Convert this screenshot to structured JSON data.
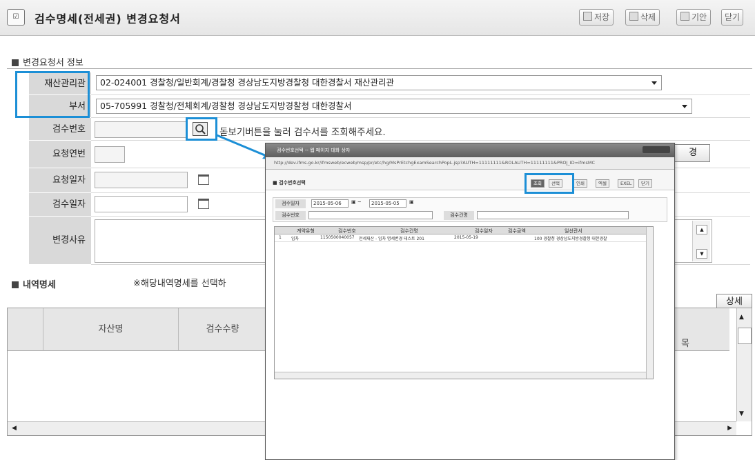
{
  "window": {
    "title": "검수명세(전세권) 변경요청서"
  },
  "toolbar": {
    "save": "저장",
    "delete": "삭제",
    "draft": "기안",
    "close": "닫기"
  },
  "section_info": {
    "title": "변경요청서 정보"
  },
  "form": {
    "asset_manager": {
      "label": "재산관리관",
      "value": "02-024001 경찰청/일반회계/경찰청 경상남도지방경찰청 대한경찰서 재산관리관"
    },
    "department": {
      "label": "부서",
      "value": "05-705991 경찰청/전체회계/경찰청 경상남도지방경찰청 대한경찰서"
    },
    "inspection_no": {
      "label": "검수번호",
      "hint": "돋보기버튼을 눌러 검수서를 조회해주세요."
    },
    "request_seq": {
      "label": "요청연번"
    },
    "request_date": {
      "label": "요청일자"
    },
    "inspection_date": {
      "label": "검수일자"
    },
    "change_reason": {
      "label": "변경사유"
    },
    "right_button": "경"
  },
  "section_detail": {
    "title": "내역명세",
    "note": "※해당내역명세를 선택하"
  },
  "grid": {
    "detail_button": "상세",
    "columns": [
      "자산명",
      "검수수량"
    ],
    "right_header_fragment": "목"
  },
  "popup": {
    "title": "검수번호선택 -- 웹 페이지 대화 상자",
    "url": "http://dev.ifms.go.kr/ifmsweb/ecweb/msp/pr/etc/hg/MsPrEtchgExamSearchPopL.jsp?AUTH=11111111&ROLAUTH=11111111&PROJ_ID=ifmsMC",
    "heading": "검수번호선택",
    "buttons": {
      "search": "조회",
      "select": "선택",
      "print": "인쇄",
      "excel": "엑셀",
      "excel2": "EXEL",
      "close": "닫기"
    },
    "filter": {
      "inspection_date_label": "검수일자",
      "date_from": "2015-05-06",
      "date_to": "2015-05-05",
      "inspection_no_label": "검수번호",
      "inspection_name_label": "검수건명"
    },
    "table": {
      "headers": [
        "계약유형",
        "검수번호",
        "검수건명",
        "검수일자",
        "검수금액",
        "일선관서"
      ],
      "rows": [
        [
          "1",
          "임차",
          "1150500040057",
          "전세재산 - 임차 명세변경 테스트 201",
          "2015-05-19",
          "",
          "100 경찰청 경상남도지방경찰청 대한경찰"
        ]
      ]
    }
  }
}
